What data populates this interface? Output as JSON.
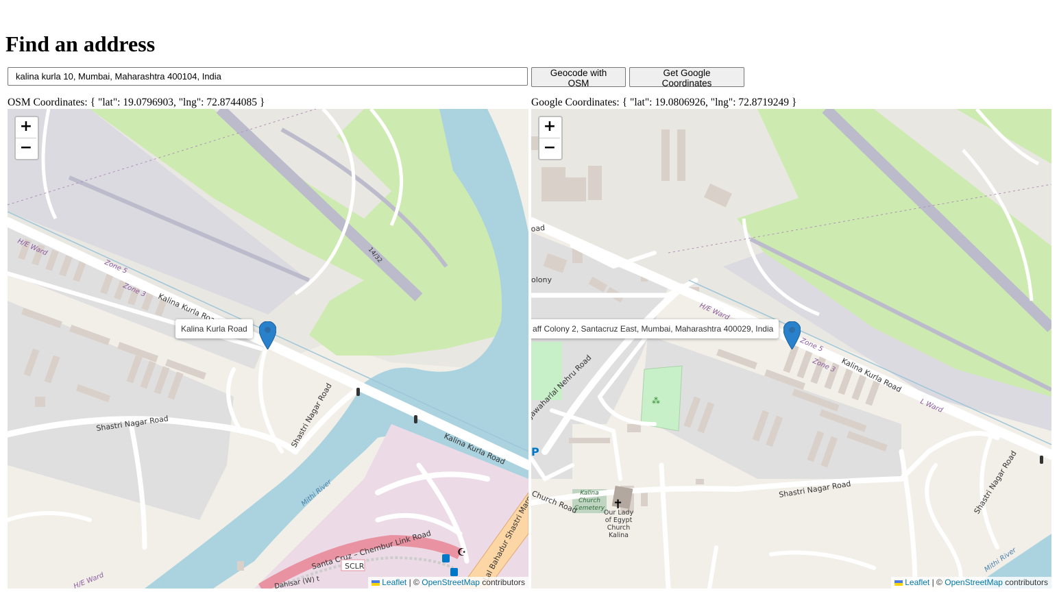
{
  "page": {
    "title": "Find an address"
  },
  "search": {
    "value": "kalina kurla 10, Mumbai, Maharashtra 400104, India"
  },
  "buttons": {
    "osm_label": "Geocode with OSM",
    "google_label": "Get Google Coordinates"
  },
  "osm": {
    "label": "OSM Coordinates:",
    "coords": "{ \"lat\": 19.0796903, \"lng\": 72.8744085 }",
    "popup": "Kalina Kurla Road",
    "map_labels": {
      "road1": "Kalina Kurla Road",
      "road2": "Kalina Kurla Road",
      "road3": "Shastri Nagar Road",
      "road4": "Shastri Nagar Road",
      "road5": "Santa Cruz – Chembur Link Road",
      "road6": "Lal Bahadur Shastri Marg",
      "road7": "Dahisar (W) t",
      "sclr": "SCLR",
      "ward1": "H/E Ward",
      "ward2": "H/E Ward",
      "zone1": "Zone 5",
      "zone2": "Zone 3",
      "runway": "14/32",
      "river": "Mithi River"
    }
  },
  "google": {
    "label": "Google Coordinates:",
    "coords": "{ \"lat\": 19.0806926, \"lng\": 72.8719249 }",
    "popup": "aff Colony 2, Santacruz East, Mumbai, Maharashtra 400029, India",
    "map_labels": {
      "road1": "Kalina Kurla Road",
      "road2": "Shastri Nagar Road",
      "road3": "Shastri Nagar Road",
      "road4": "Jawaharlal Nehru Road",
      "road5": "Church Road",
      "road6": "oad",
      "colony": "olony",
      "ward1": "H/E Ward",
      "ward2": "L Ward",
      "zone1": "Zone 5",
      "zone2": "Zone 3",
      "cemetery": "Kalina Church Cemetery",
      "church": "Our Lady of Egypt Church Kalina",
      "river": "Mithi River"
    }
  },
  "zoom": {
    "in": "+",
    "out": "−"
  },
  "attribution": {
    "leaflet": "Leaflet",
    "sep": "| ©",
    "osm": "OpenStreetMap",
    "contributors": "contributors"
  },
  "colors": {
    "land": "#f2efe9",
    "airport": "#e9e7e2",
    "runway_area": "#dadae0",
    "runway": "#bbbbcc",
    "grass": "#cdebb0",
    "water": "#aad3df",
    "residential": "#e0dfdf",
    "building": "#d9d0c9",
    "commercial": "#ecdbe6",
    "primary_road": "#fcd6a4",
    "motorway": "#e892a2",
    "marker": "#2a81cb",
    "link": "#0078a8"
  }
}
